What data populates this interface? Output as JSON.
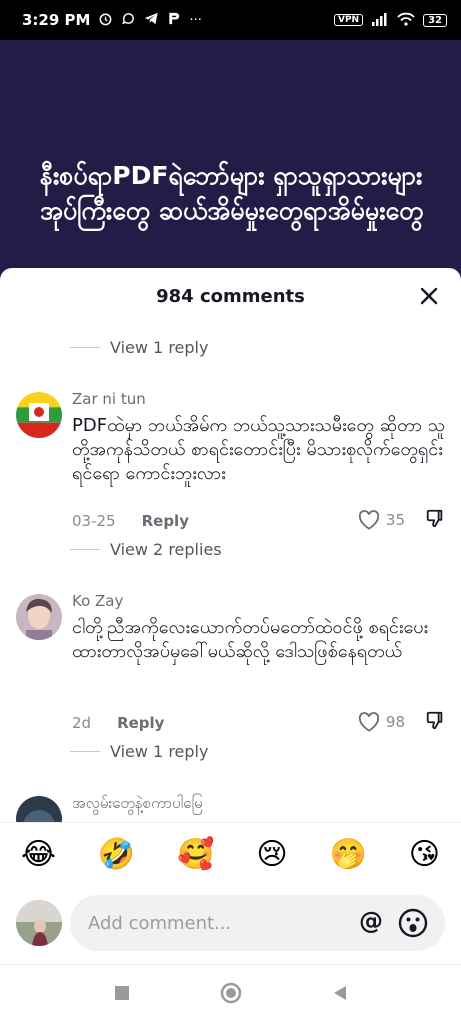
{
  "status_bar": {
    "time": "3:29 PM",
    "vpn": "VPN",
    "battery": "32",
    "dots": "···",
    "icons": [
      "alarm-icon",
      "viber-icon",
      "telegram-icon",
      "p-icon",
      "signal-icon",
      "wifi-icon"
    ]
  },
  "video": {
    "caption": "နီးစပ်ရာPDFရဲဘော်များ ရှာသူရှာသားများအုပ်ကြီးတွေ ဆယ်အိမ်မှုးတွေရာအိမ်မှုးတွေ"
  },
  "sheet": {
    "title": "984 comments"
  },
  "comments": [
    {
      "type": "view_replies",
      "label": "View 1 reply"
    },
    {
      "type": "comment",
      "user": "Zar ni tun",
      "text": "PDFထဲမှာ ဘယ်အိမ်က ဘယ်သူ့သားသမီးတွေ ဆိုတာ သူတို့အကုန်သိတယ် စာရင်းတောင်းပြီး မိသားစုလိုက်တွေရှင်းရင်ရော ကောင်းဘူးလား",
      "date": "03-25",
      "reply": "Reply",
      "likes": "35"
    },
    {
      "type": "view_replies",
      "label": "View 2 replies"
    },
    {
      "type": "comment",
      "user": "Ko Zay",
      "text": "ငါတို့ညီအကိုလေးယောက်တပ်မတော်ထဲဝင်ဖို့ စရင်းပေးထားတာလိုအပ်မှခေါ်မယ်ဆိုလို့ ဒေါသဖြစ်နေရတယ်",
      "date": "2d",
      "reply": "Reply",
      "likes": "98"
    },
    {
      "type": "view_replies",
      "label": "View 1 reply"
    },
    {
      "type": "comment",
      "user": "အလွမ်းတွေနဲ့စကာပါမြေ",
      "text": ""
    }
  ],
  "emoji_bar": [
    "😂",
    "🤣",
    "🥰",
    "😢",
    "🤭",
    "😘"
  ],
  "input": {
    "placeholder": "Add comment...",
    "at": "@"
  },
  "colors": {
    "video_bg": "#221d47",
    "sheet_bg": "#ffffff",
    "text_primary": "#161823",
    "text_secondary": "#8a8b91"
  }
}
